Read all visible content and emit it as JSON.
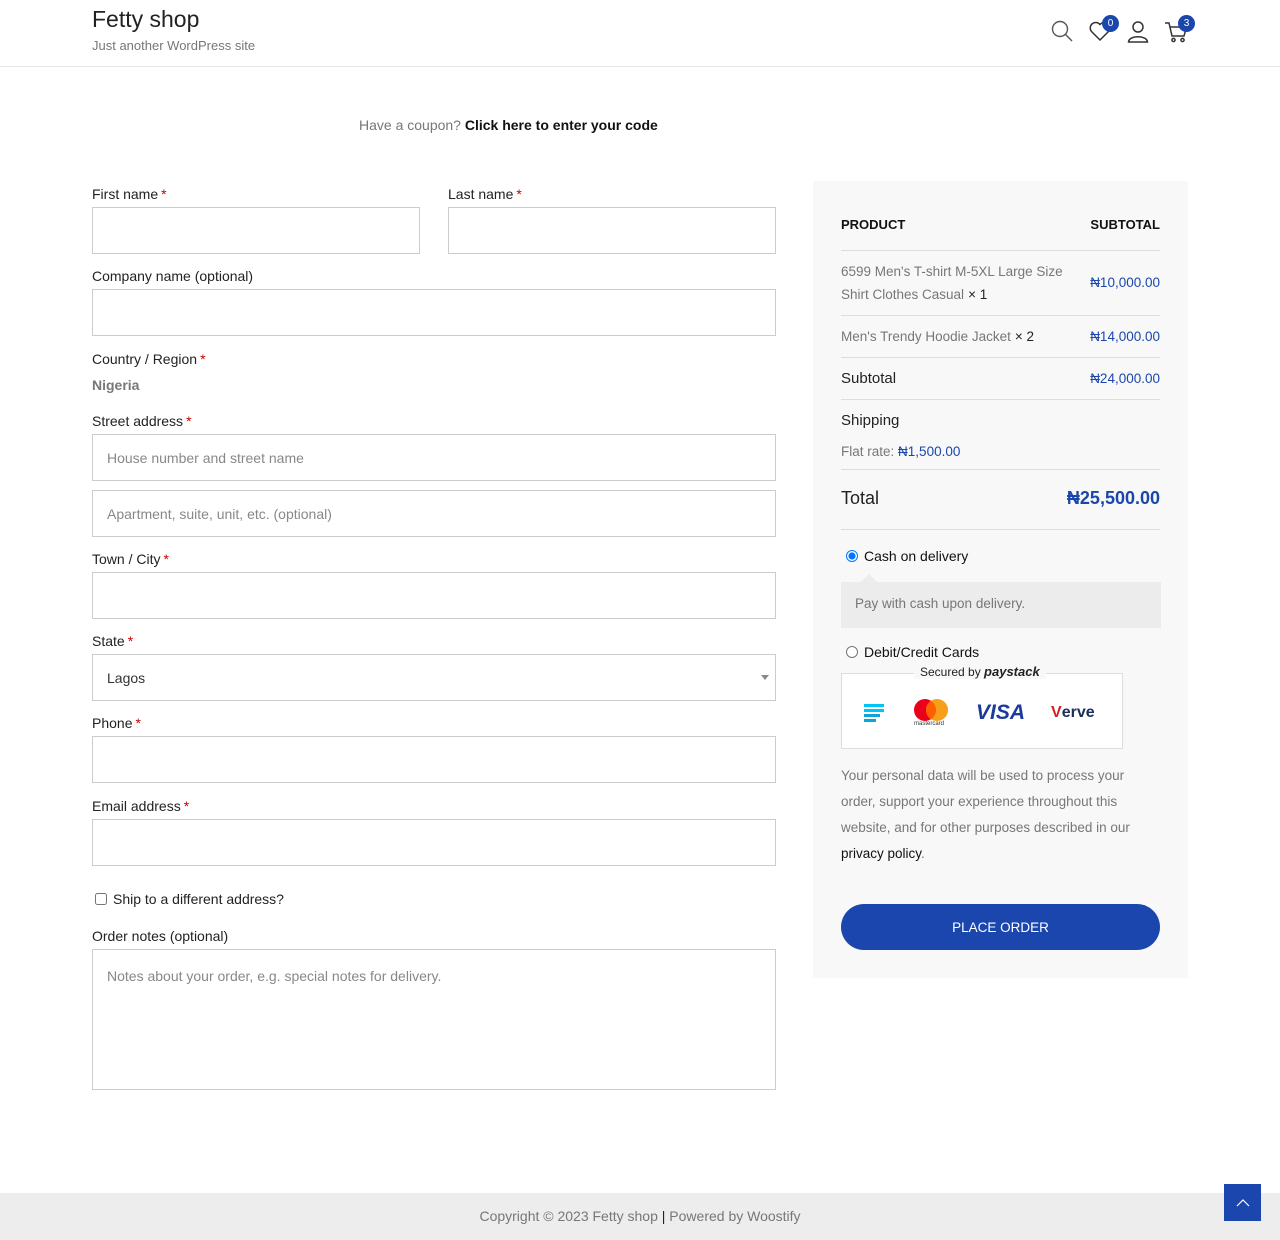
{
  "header": {
    "site_title": "Fetty shop",
    "tagline": "Just another WordPress site",
    "wishlist_count": "0",
    "cart_count": "3"
  },
  "coupon": {
    "prompt": "Have a coupon?",
    "link": "Click here to enter your code"
  },
  "billing": {
    "first_name_label": "First name",
    "last_name_label": "Last name",
    "company_label": "Company name (optional)",
    "country_label": "Country / Region",
    "country_value": "Nigeria",
    "street_label": "Street address",
    "street_placeholder": "House number and street name",
    "apartment_placeholder": "Apartment, suite, unit, etc. (optional)",
    "city_label": "Town / City",
    "state_label": "State",
    "state_value": "Lagos",
    "phone_label": "Phone",
    "email_label": "Email address",
    "required_mark": "*",
    "ship_different": "Ship to a different address?",
    "notes_label": "Order notes (optional)",
    "notes_placeholder": "Notes about your order, e.g. special notes for delivery."
  },
  "order": {
    "col_product": "Product",
    "col_subtotal": "Subtotal",
    "items": [
      {
        "name": "6599 Men's T-shirt M-5XL Large Size Shirt Clothes Casual",
        "qty": "× 1",
        "price": "₦10,000.00"
      },
      {
        "name": "Men's Trendy Hoodie Jacket",
        "qty": "× 2",
        "price": "₦14,000.00"
      }
    ],
    "subtotal_label": "Subtotal",
    "subtotal_value": "₦24,000.00",
    "shipping_label": "Shipping",
    "flat_rate_label": "Flat rate:",
    "flat_rate_value": "₦1,500.00",
    "total_label": "Total",
    "total_value": "₦25,500.00"
  },
  "payment": {
    "cod_label": "Cash on delivery",
    "cod_desc": "Pay with cash upon delivery.",
    "card_label": "Debit/Credit Cards",
    "secured_by": "Secured by",
    "paystack": "paystack",
    "mastercard_text": "mastercard",
    "visa": "VISA",
    "verve_v": "V",
    "verve_rest": "erve",
    "privacy_text": "Your personal data will be used to process your order, support your experience throughout this website, and for other purposes described in our",
    "privacy_link": "privacy policy",
    "privacy_end": ".",
    "place_order": "Place order"
  },
  "footer": {
    "copyright": "Copyright © 2023 Fetty shop",
    "separator": "|",
    "powered": "Powered by Woostify"
  },
  "colors": {
    "accent": "#1a46ad",
    "required": "#cc0000"
  }
}
